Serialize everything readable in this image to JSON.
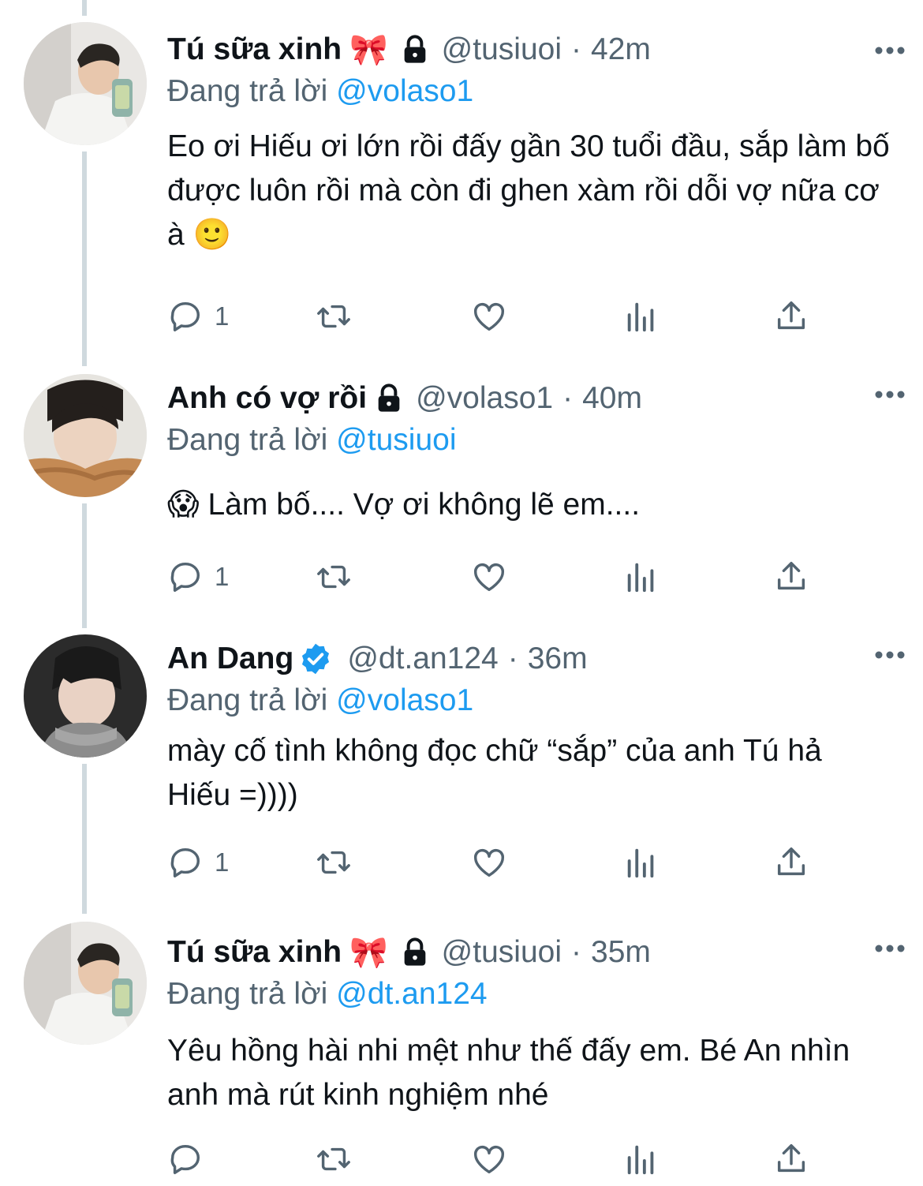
{
  "tweets": [
    {
      "name": "Tú sữa xinh",
      "emoji": "🎀",
      "handle": "@tusiuoi",
      "dot": "·",
      "time": "42m",
      "replying_prefix": "Đang trả lời",
      "replying_to": "@volaso1",
      "text": "Eo ơi Hiếu ơi lớn rồi đấy gần 30 tuổi đầu, sắp làm bố được luôn rồi mà còn đi ghen xàm rồi dỗi vợ nữa cơ à 🙂",
      "reply_count": "1",
      "verified": false,
      "locked": true,
      "avatar": "avatar-tu"
    },
    {
      "name": "Anh có vợ rồi",
      "emoji": "",
      "handle": "@volaso1",
      "dot": "·",
      "time": "40m",
      "replying_prefix": "Đang trả lời",
      "replying_to": "@tusiuoi",
      "text": "😱 Làm bố.... Vợ ơi không lẽ em....",
      "reply_count": "1",
      "verified": false,
      "locked": true,
      "avatar": "avatar-hieu"
    },
    {
      "name": "An Dang",
      "emoji": "",
      "handle": "@dt.an124",
      "dot": "·",
      "time": "36m",
      "replying_prefix": "Đang trả lời",
      "replying_to": "@volaso1",
      "text": "mày cố tình không đọc chữ “sắp” của anh Tú hả Hiếu =))))",
      "reply_count": "1",
      "verified": true,
      "locked": false,
      "avatar": "avatar-an"
    },
    {
      "name": "Tú sữa xinh",
      "emoji": "🎀",
      "handle": "@tusiuoi",
      "dot": "·",
      "time": "35m",
      "replying_prefix": "Đang trả lời",
      "replying_to": "@dt.an124",
      "text": "Yêu hồng hài nhi mệt như thế đấy em. Bé An nhìn anh mà rút kinh nghiệm nhé",
      "reply_count": "",
      "verified": false,
      "locked": true,
      "avatar": "avatar-tu"
    }
  ],
  "icons": {
    "reply": "reply-icon",
    "retweet": "retweet-icon",
    "like": "like-icon",
    "views": "views-icon",
    "share": "share-icon",
    "more": "more-icon",
    "lock": "lock-icon",
    "verified": "verified-badge-icon"
  },
  "colors": {
    "link": "#1d9bf0",
    "secondary_text": "#536471",
    "thread_line": "#cfd9de",
    "verified": "#1d9bf0"
  }
}
